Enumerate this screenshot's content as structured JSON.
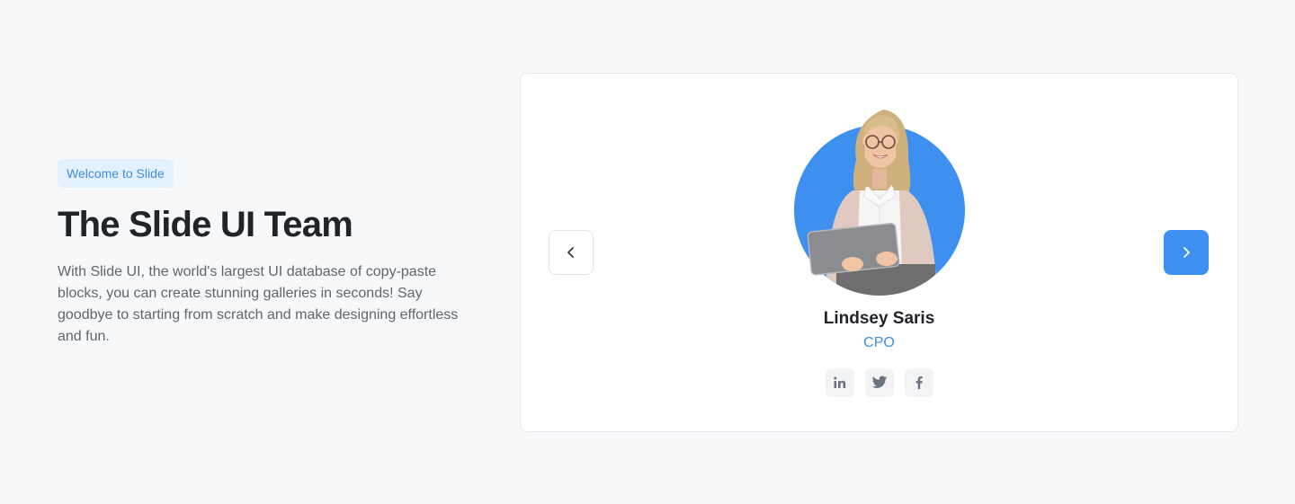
{
  "hero": {
    "badge": "Welcome to Slide",
    "title": "The Slide UI Team",
    "description": "With Slide UI, the world's largest UI database of copy-paste blocks, you can create stunning galleries in seconds! Say goodbye to starting from scratch and make designing effortless and fun."
  },
  "carousel": {
    "prev_icon": "chevron-left-icon",
    "next_icon": "chevron-right-icon",
    "member": {
      "name": "Lindsey Saris",
      "role": "CPO",
      "socials": [
        "linkedin-icon",
        "twitter-icon",
        "facebook-icon"
      ]
    }
  },
  "colors": {
    "accent": "#3d8ff0",
    "badge_bg": "#e3f0fd",
    "page_bg": "#f7f8fa"
  }
}
